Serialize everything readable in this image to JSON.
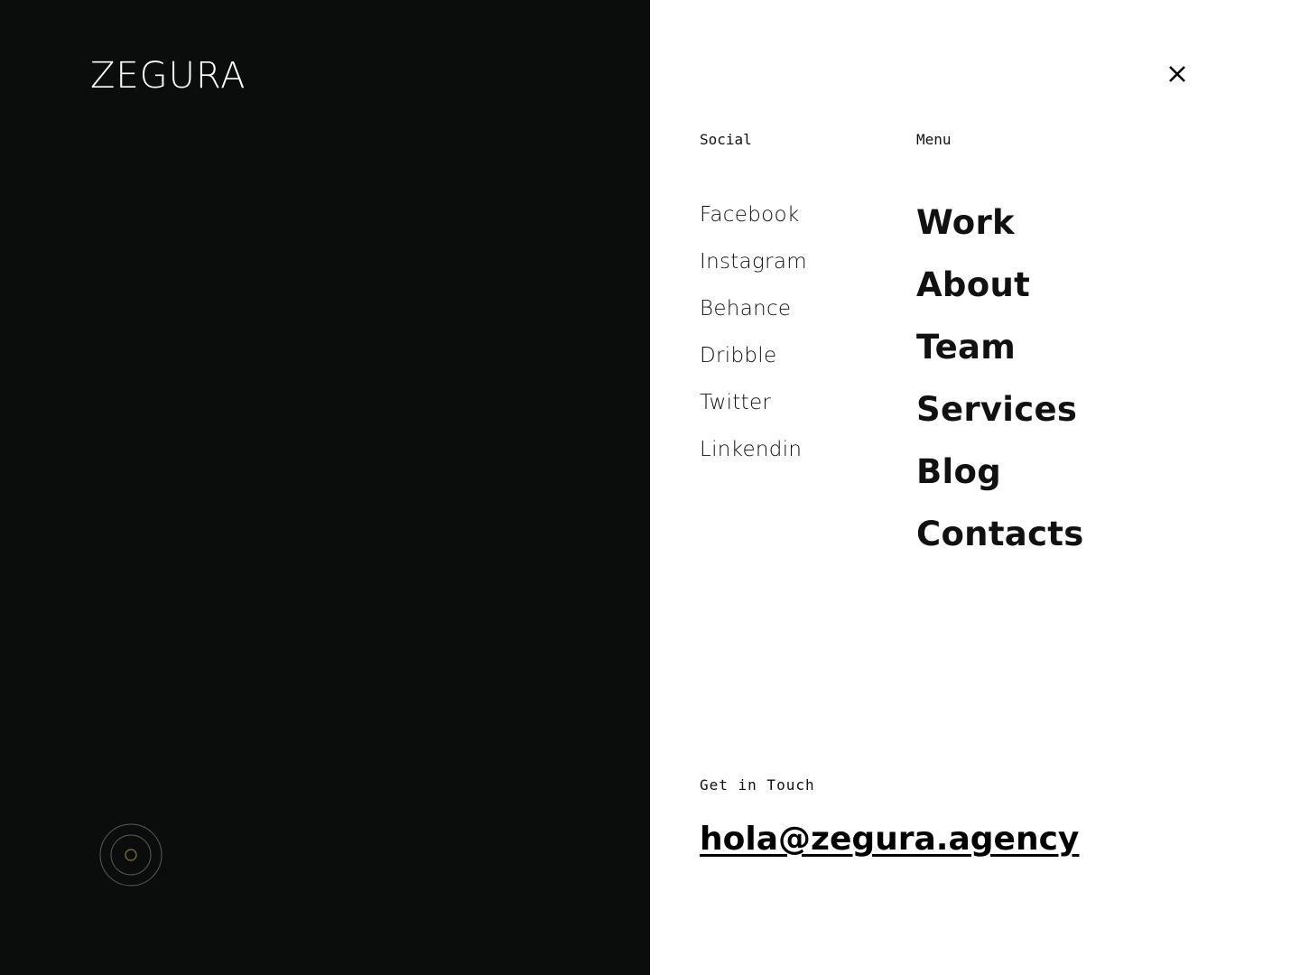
{
  "brand": {
    "logo_text": "ZEGURA"
  },
  "colors": {
    "left_panel_bg": "#0b0d0d",
    "right_panel_bg": "#ffffff",
    "text_dark": "#111111",
    "scroll_ring": "#5a5a5a",
    "scroll_dot": "#8a7a3a"
  },
  "icons": {
    "close": "close-icon",
    "scroll_indicator": "scroll-indicator-icon"
  },
  "social": {
    "label": "Social",
    "items": [
      "Facebook",
      "Instagram",
      "Behance",
      "Dribble",
      "Twitter",
      "Linkendin"
    ]
  },
  "menu": {
    "label": "Menu",
    "items": [
      "Work",
      "About",
      "Team",
      "Services",
      "Blog",
      "Contacts"
    ]
  },
  "contact": {
    "label": "Get in Touch",
    "email": "hola@zegura.agency"
  }
}
